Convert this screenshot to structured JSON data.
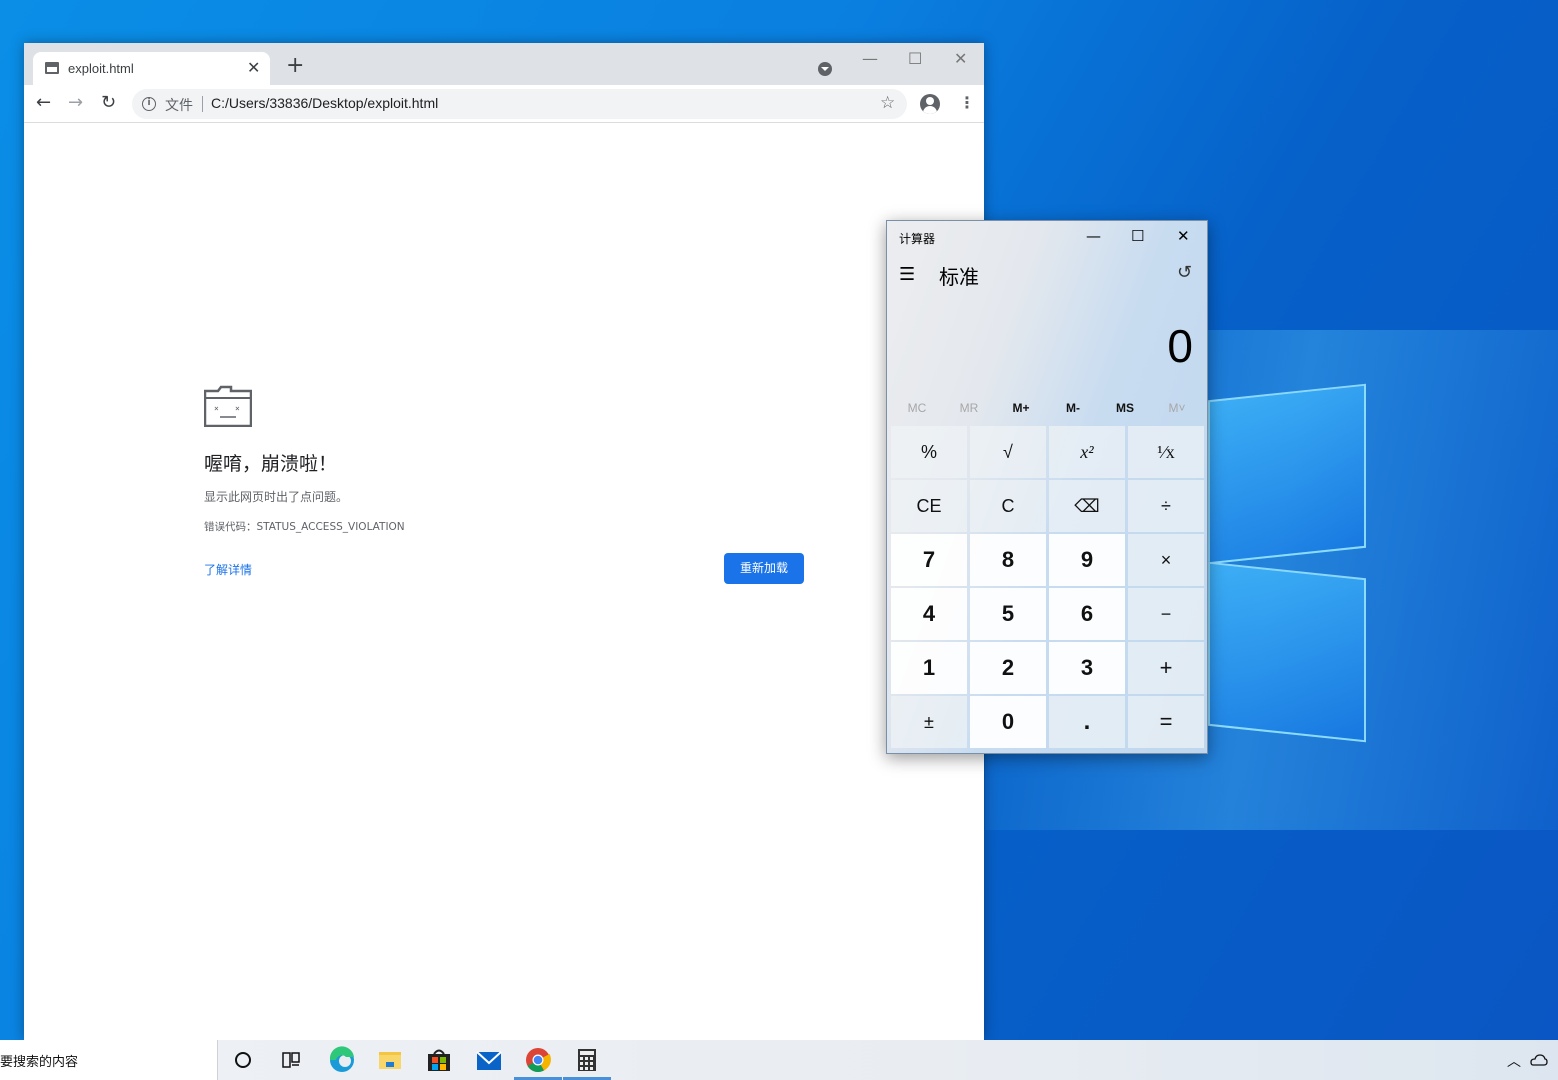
{
  "browser": {
    "tab_title": "exploit.html",
    "tab_close": "✕",
    "new_tab": "+",
    "minimize": "—",
    "maximize": "☐",
    "close": "✕",
    "back": "←",
    "forward": "→",
    "reload": "↻",
    "security_label": "文件",
    "url": "C:/Users/33836/Desktop/exploit.html",
    "bookmark": "☆",
    "menu": "⋮"
  },
  "crash_page": {
    "title": "喔唷，崩溃啦！",
    "description": "显示此网页时出了点问题。",
    "error_code": "错误代码：STATUS_ACCESS_VIOLATION",
    "learn_more": "了解详情",
    "reload_button": "重新加载"
  },
  "calculator": {
    "window_title": "计算器",
    "minimize": "—",
    "maximize": "☐",
    "close": "✕",
    "menu": "☰",
    "mode": "标准",
    "history": "↺",
    "display": "0",
    "memory": [
      "MC",
      "MR",
      "M+",
      "M-",
      "MS",
      "M˅"
    ],
    "keys": [
      "%",
      "√",
      "x²",
      "¹⁄x",
      "CE",
      "C",
      "⌫",
      "÷",
      "7",
      "8",
      "9",
      "×",
      "4",
      "5",
      "6",
      "−",
      "1",
      "2",
      "3",
      "+",
      "±",
      "0",
      ".",
      "="
    ]
  },
  "taskbar": {
    "search_placeholder": "要搜索的内容",
    "cortana": "○",
    "tray_chevron": "︿"
  },
  "colors": {
    "chrome_blue": "#1a73e8",
    "desktop_blue": "#0a7fe0"
  }
}
